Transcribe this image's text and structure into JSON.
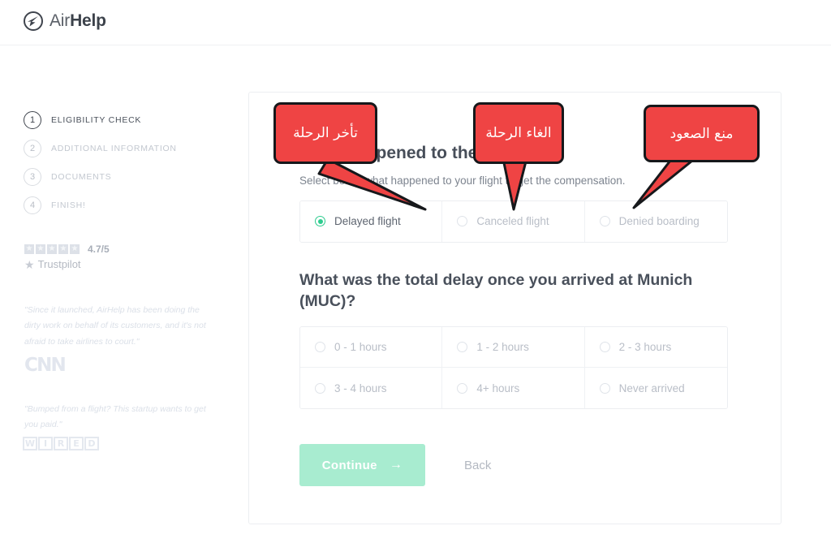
{
  "brand": {
    "name_light": "Air",
    "name_bold": "Help",
    "logo_icon": "airhelp-circle-icon",
    "accent_red": "#ef4444",
    "accent_green": "#2ecc8f",
    "button_green": "#a8ecd0"
  },
  "sidebar": {
    "steps": [
      {
        "num": "1",
        "label": "ELIGIBILITY CHECK",
        "active": true
      },
      {
        "num": "2",
        "label": "ADDITIONAL INFORMATION",
        "active": false
      },
      {
        "num": "3",
        "label": "DOCUMENTS",
        "active": false
      },
      {
        "num": "4",
        "label": "FINISH!",
        "active": false
      }
    ],
    "trustpilot": {
      "score": "4.7/5",
      "name": "Trustpilot",
      "stars": 5
    },
    "press": [
      {
        "quote": "\"Since it launched, AirHelp has been doing the dirty work on behalf of its customers, and it's not afraid to take airlines to court.\"",
        "logo": "CNN"
      },
      {
        "quote": "\"Bumped from a flight? This startup wants to get you paid.\"",
        "logo": "WIRED",
        "logo_letters": [
          "W",
          "I",
          "R",
          "E",
          "D"
        ]
      }
    ]
  },
  "main": {
    "question1": {
      "title": "What happened to the flight?",
      "subtitle": "Select below what happened to your flight to get the compensation.",
      "options": [
        {
          "label": "Delayed flight",
          "selected": true
        },
        {
          "label": "Canceled flight",
          "selected": false
        },
        {
          "label": "Denied boarding",
          "selected": false
        }
      ]
    },
    "question2": {
      "title": "What was the total delay once you arrived at Munich (MUC)?",
      "options": [
        {
          "label": "0 - 1 hours",
          "selected": false
        },
        {
          "label": "1 - 2 hours",
          "selected": false
        },
        {
          "label": "2 - 3 hours",
          "selected": false
        },
        {
          "label": "3 - 4 hours",
          "selected": false
        },
        {
          "label": "4+ hours",
          "selected": false
        },
        {
          "label": "Never arrived",
          "selected": false
        }
      ]
    },
    "actions": {
      "continue_label": "Continue",
      "continue_arrow": "→",
      "back_label": "Back"
    }
  },
  "callouts": [
    {
      "text": "تأخر الرحلة",
      "points_to": "Delayed flight"
    },
    {
      "text": "الغاء الرحلة",
      "points_to": "Canceled flight"
    },
    {
      "text": "منع الصعود",
      "points_to": "Denied boarding"
    }
  ]
}
